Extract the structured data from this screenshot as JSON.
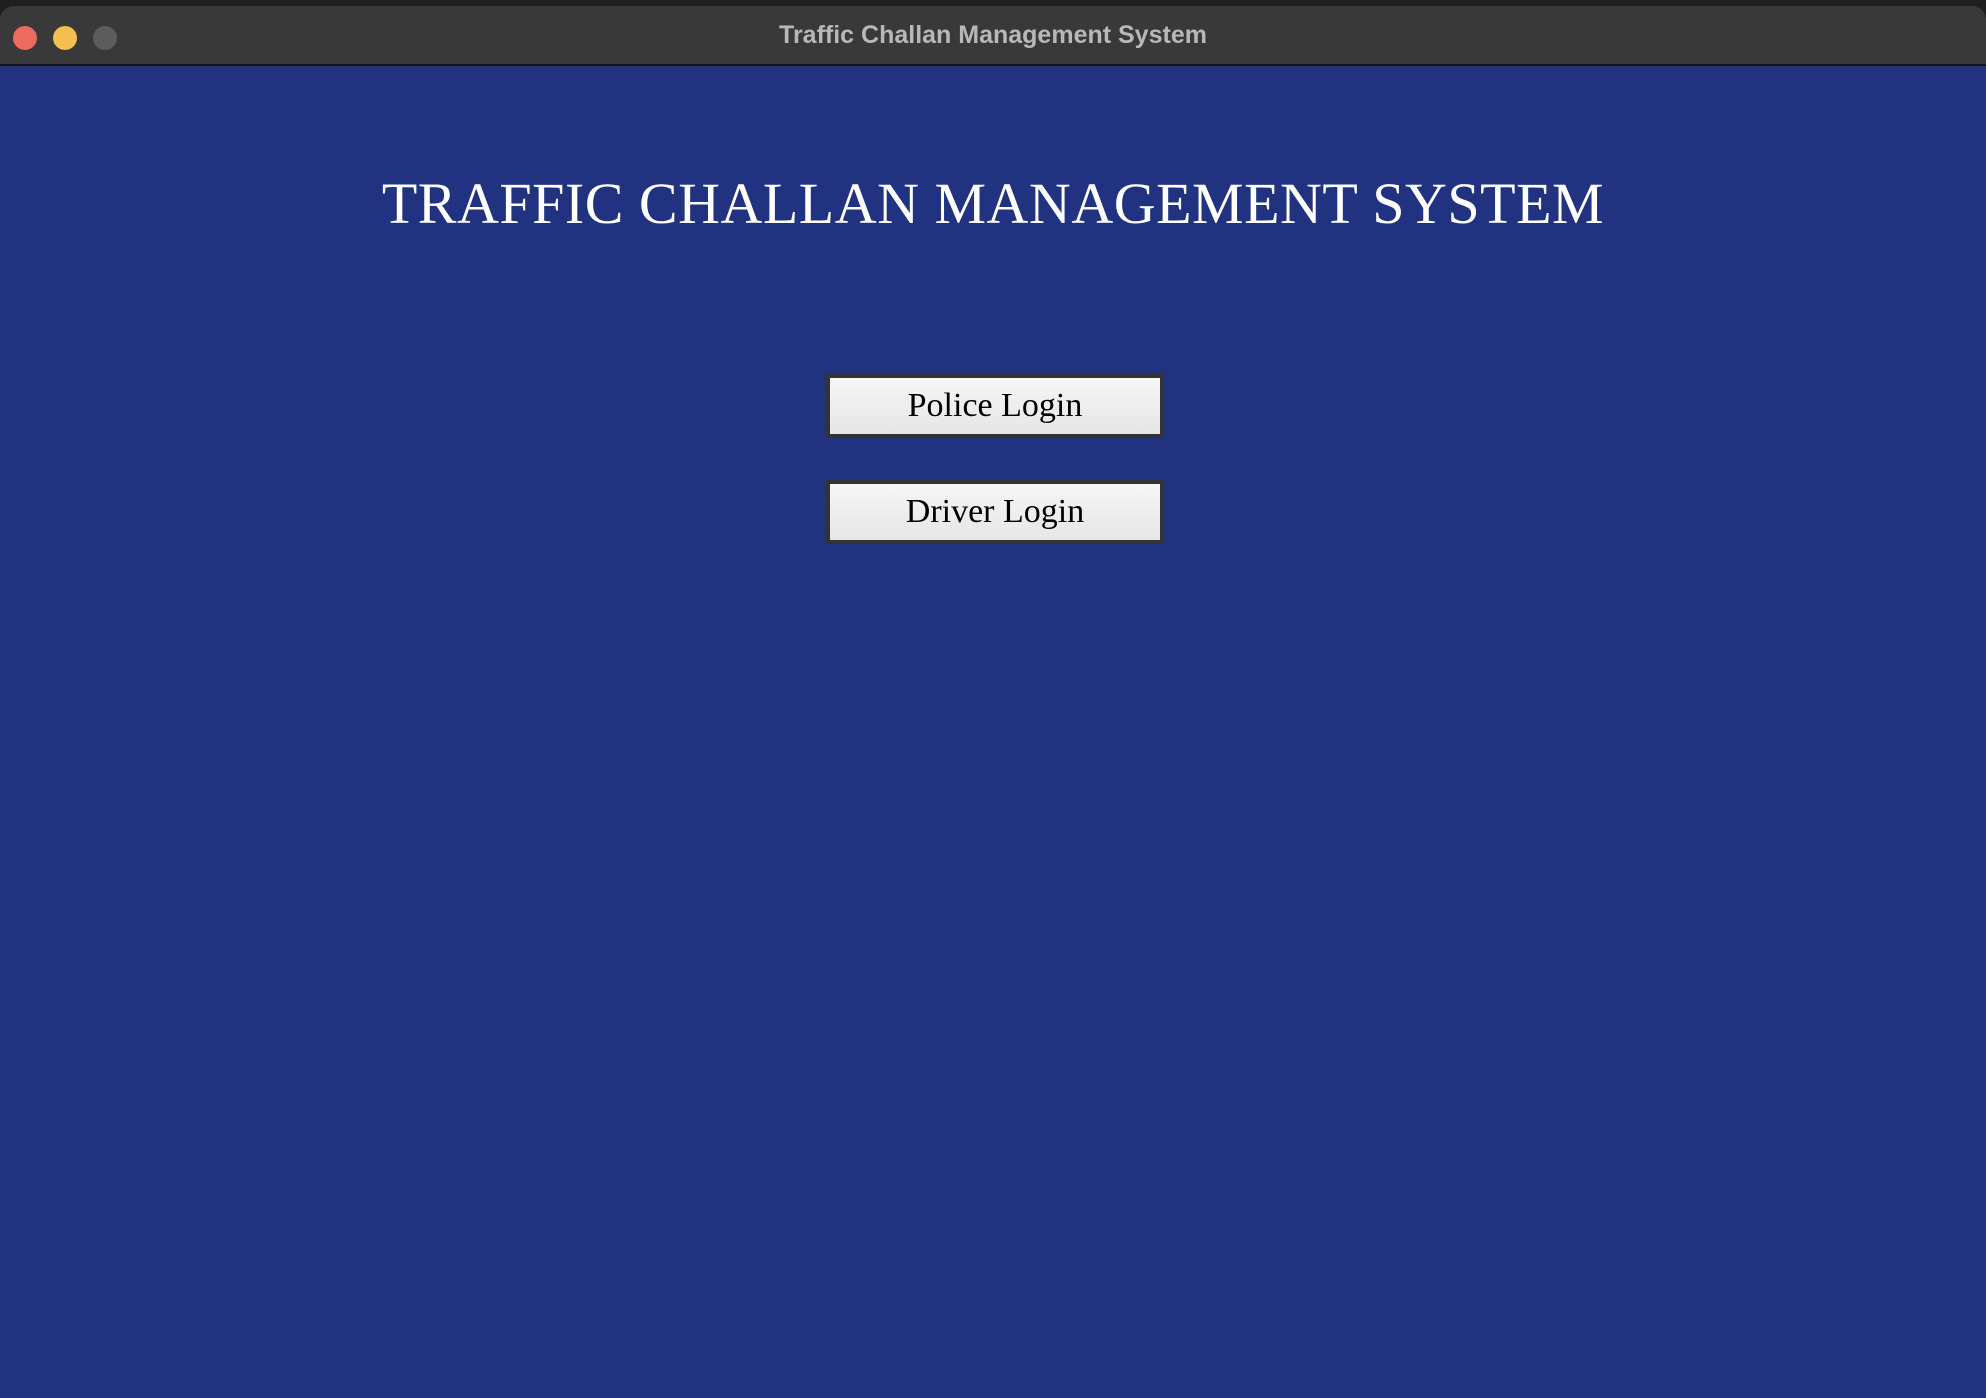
{
  "window": {
    "title": "Traffic Challan Management System"
  },
  "main": {
    "heading": "TRAFFIC CHALLAN MANAGEMENT SYSTEM",
    "buttons": {
      "police_login": "Police Login",
      "driver_login": "Driver Login"
    }
  },
  "colors": {
    "background": "#213380",
    "titlebar": "#3a3939",
    "heading_text": "#ffffff",
    "button_face": "#eeeeee",
    "button_border": "#333333"
  }
}
